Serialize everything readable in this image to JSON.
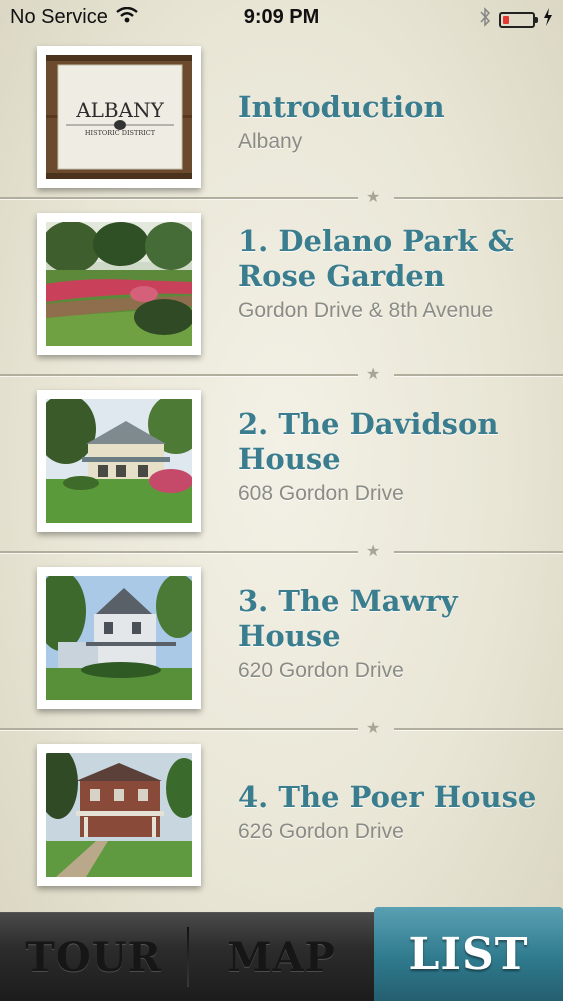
{
  "status_bar": {
    "carrier": "No Service",
    "time": "9:09 PM",
    "battery_level": 0.22,
    "battery_color": "#e23a32"
  },
  "stops": [
    {
      "title": "Introduction",
      "subtitle": "Albany",
      "thumb_logo_name": "ALBANY",
      "thumb_logo_sub": "HISTORIC DISTRICT"
    },
    {
      "title": "1. Delano Park & Rose Garden",
      "subtitle": "Gordon Drive & 8th Avenue"
    },
    {
      "title": "2. The Davidson House",
      "subtitle": "608 Gordon Drive"
    },
    {
      "title": "3. The Mawry House",
      "subtitle": "620 Gordon Drive"
    },
    {
      "title": "4. The Poer House",
      "subtitle": "626 Gordon Drive"
    }
  ],
  "tabs": {
    "tour": "TOUR",
    "map": "MAP",
    "list": "LIST",
    "active": "list"
  },
  "colors": {
    "title": "#3a7d8e",
    "subtitle": "#8c8c86",
    "active_tab": "#2f7a8d"
  }
}
